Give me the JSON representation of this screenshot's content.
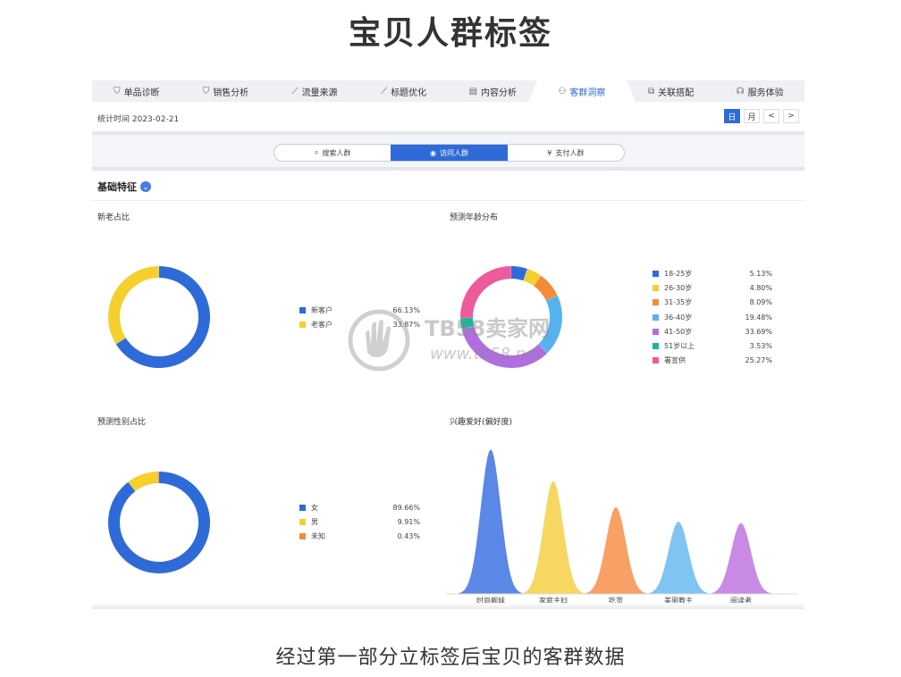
{
  "page": {
    "title": "宝贝人群标签",
    "caption": "经过第一部分立标签后宝贝的客群数据"
  },
  "tabs": [
    {
      "label": "单品诊断",
      "icon": "bag-icon"
    },
    {
      "label": "销售分析",
      "icon": "bag-icon"
    },
    {
      "label": "流量来源",
      "icon": "line-chart-icon"
    },
    {
      "label": "标题优化",
      "icon": "line-chart-icon"
    },
    {
      "label": "内容分析",
      "icon": "document-icon"
    },
    {
      "label": "客群洞察",
      "icon": "users-icon",
      "active": true
    },
    {
      "label": "关联搭配",
      "icon": "link-icon"
    },
    {
      "label": "服务体验",
      "icon": "headset-icon"
    }
  ],
  "stat_time": "统计时间 2023-02-21",
  "date_controls": {
    "day": "日",
    "month": "月",
    "prev": "<",
    "next": ">"
  },
  "segments": [
    {
      "label": "搜索人群",
      "icon": "search-icon"
    },
    {
      "label": "访问人群",
      "icon": "eye-icon",
      "active": true
    },
    {
      "label": "支付人群",
      "icon": "yen-icon"
    }
  ],
  "section_title": "基础特征",
  "colors": {
    "accent": "#2f6bd8",
    "blue": "#2f6bd8",
    "yellow": "#f5cf2e",
    "orange": "#f58a3a",
    "lightblue": "#57b3f0",
    "purple": "#b06ee0",
    "teal": "#16b89a",
    "pink": "#ee5a9a"
  },
  "panels": {
    "new_old": {
      "title": "新老占比",
      "chart_data": {
        "type": "pie",
        "categories": [
          "新客户",
          "老客户"
        ],
        "labels": [
          "66.13%",
          "33.87%"
        ],
        "values": [
          66.13,
          33.87
        ],
        "colors": [
          "#2f6bd8",
          "#f5cf2e"
        ]
      }
    },
    "age": {
      "title": "预测年龄分布",
      "chart_data": {
        "type": "pie",
        "categories": [
          "18-25岁",
          "26-30岁",
          "31-35岁",
          "36-40岁",
          "41-50岁",
          "51岁以上",
          "署宣供"
        ],
        "labels": [
          "5.13%",
          "4.80%",
          "8.09%",
          "19.48%",
          "33.69%",
          "3.53%",
          "25.27%"
        ],
        "values": [
          5.13,
          4.8,
          8.09,
          19.48,
          33.69,
          3.53,
          25.27
        ],
        "colors": [
          "#2f6bd8",
          "#f5cf2e",
          "#f58a3a",
          "#57b3f0",
          "#b06ee0",
          "#16b89a",
          "#ee5a9a"
        ]
      }
    },
    "gender": {
      "title": "预测性别占比",
      "chart_data": {
        "type": "pie",
        "categories": [
          "女",
          "男",
          "未知"
        ],
        "labels": [
          "89.66%",
          "9.91%",
          "0.43%"
        ],
        "values": [
          89.66,
          9.91,
          0.43
        ],
        "colors": [
          "#2f6bd8",
          "#f5cf2e",
          "#f58a3a"
        ]
      }
    },
    "interest": {
      "title": "兴趣爱好(偏好度)",
      "chart_data": {
        "type": "area",
        "categories": [
          "时尚靓妹",
          "家庭主妇",
          "吃货",
          "美丽教主",
          "阅读者"
        ],
        "values": [
          100,
          78,
          60,
          50,
          49
        ],
        "colors": [
          "#5b87e6",
          "#f7d761",
          "#f8a066",
          "#7fc4f3",
          "#c98ae6"
        ]
      }
    }
  },
  "watermark": {
    "line1": "TB58卖家网",
    "line2": "www.tb58.net"
  }
}
